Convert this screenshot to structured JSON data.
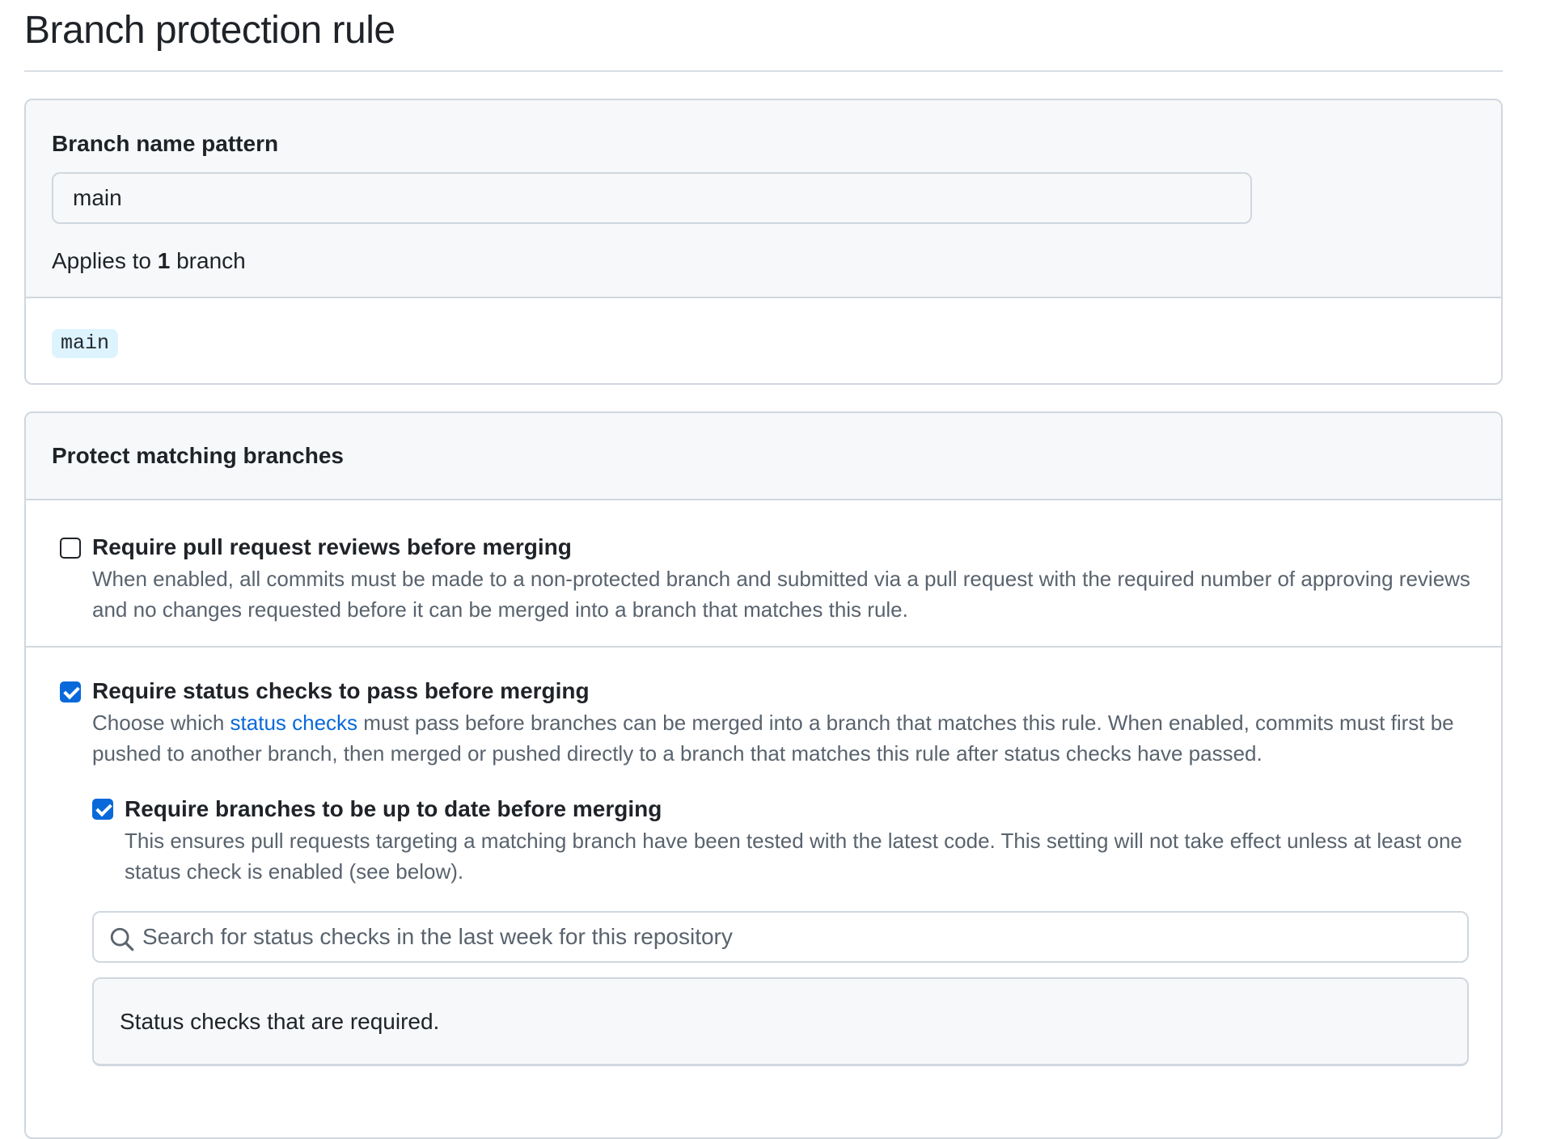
{
  "page": {
    "title": "Branch protection rule"
  },
  "pattern": {
    "label": "Branch name pattern",
    "value": "main",
    "applies_prefix": "Applies to",
    "applies_count": "1",
    "applies_suffix": "branch",
    "matched_branches": [
      "main"
    ]
  },
  "protect": {
    "header": "Protect matching branches",
    "require_pr": {
      "checked": false,
      "title": "Require pull request reviews before merging",
      "description": "When enabled, all commits must be made to a non-protected branch and submitted via a pull request with the required number of approving reviews and no changes requested before it can be merged into a branch that matches this rule."
    },
    "require_status": {
      "checked": true,
      "title": "Require status checks to pass before merging",
      "desc_before_link": "Choose which",
      "link_text": "status checks",
      "desc_after_link": "must pass before branches can be merged into a branch that matches this rule. When enabled, commits must first be pushed to another branch, then merged or pushed directly to a branch that matches this rule after status checks have passed.",
      "up_to_date": {
        "checked": true,
        "title": "Require branches to be up to date before merging",
        "description": "This ensures pull requests targeting a matching branch have been tested with the latest code. This setting will not take effect unless at least one status check is enabled (see below)."
      },
      "search": {
        "placeholder": "Search for status checks in the last week for this repository"
      },
      "required_label": "Status checks that are required."
    }
  },
  "colors": {
    "accent": "#0969da",
    "border": "#d0d7de",
    "header_bg": "#f6f8fa",
    "chip_bg": "#ddf4ff"
  }
}
